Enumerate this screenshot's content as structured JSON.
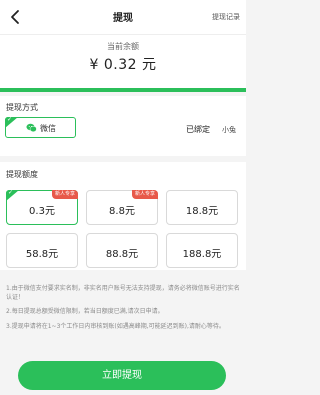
{
  "header": {
    "title": "提现",
    "history_label": "提现记录"
  },
  "balance": {
    "label": "当前余额",
    "amount": "¥ 0.32 元"
  },
  "payment": {
    "section_title": "提现方式",
    "method_name": "微信",
    "method_icon": "wechat-icon",
    "status": "已绑定",
    "nickname": "小兔"
  },
  "amounts": {
    "section_title": "提现额度",
    "tag_label": "新人专享",
    "options": [
      {
        "value": "0.3元",
        "selected": true,
        "tag": "新人专享"
      },
      {
        "value": "8.8元",
        "selected": false,
        "tag": "新人专享"
      },
      {
        "value": "18.8元",
        "selected": false,
        "tag": ""
      },
      {
        "value": "58.8元",
        "selected": false,
        "tag": ""
      },
      {
        "value": "88.8元",
        "selected": false,
        "tag": ""
      },
      {
        "value": "188.8元",
        "selected": false,
        "tag": ""
      }
    ]
  },
  "notes": [
    "1.由于微信支付要求实名制，非实名用户账号无法支持提现，请务必将微信账号进行实名认证！",
    "2.每日提现总额受微信限制，若当日额度已满,请次日申请。",
    "3.提现申请将在1~3个工作日内审核到账(如遇高峰期,可能延迟到账),请耐心等待。"
  ],
  "submit_label": "立即提现",
  "colors": {
    "accent": "#2bbf5a",
    "tag": "#e8594a"
  }
}
